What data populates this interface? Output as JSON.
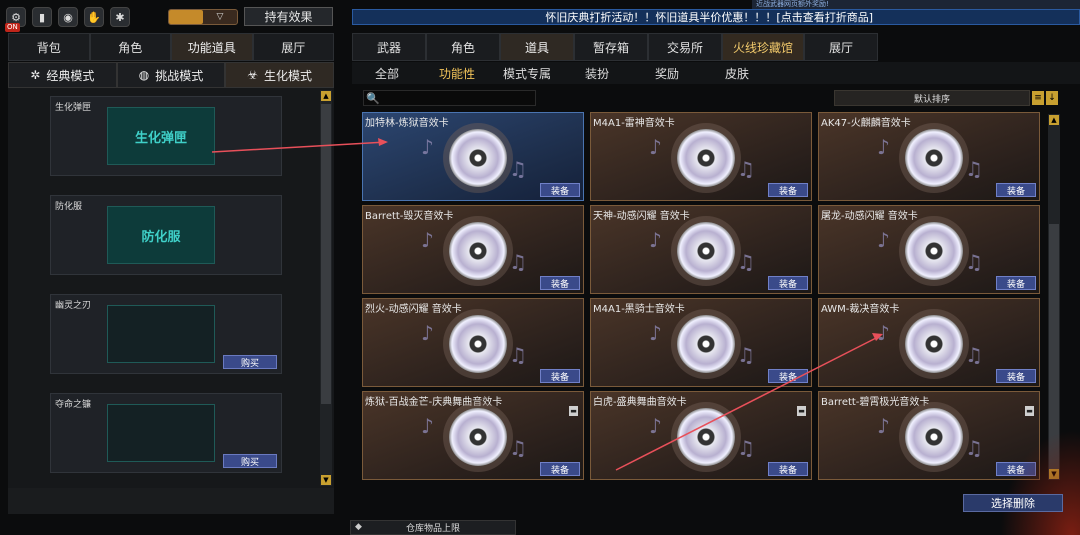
{
  "top": {
    "on_badge": "ON",
    "toggle": [
      "",
      "▽"
    ],
    "have_effect": "持有效果"
  },
  "banner": {
    "top_text": "近战武器网页额外奖励!",
    "text": "怀旧庆典打折活动！！怀旧道具半价优惠！！！[点击查看打折商品]"
  },
  "left": {
    "tabs": [
      "背包",
      "角色",
      "功能道具",
      "展厅"
    ],
    "selected_tab": 2,
    "modes": [
      {
        "label": "经典模式",
        "icon": "classic-mode-icon"
      },
      {
        "label": "挑战模式",
        "icon": "challenge-mode-icon"
      },
      {
        "label": "生化模式",
        "icon": "biohazard-mode-icon"
      }
    ],
    "selected_mode": 2,
    "items": [
      {
        "name": "生化弹匣",
        "art": "生化弹匣",
        "buy": ""
      },
      {
        "name": "防化服",
        "art": "防化服",
        "buy": ""
      },
      {
        "name": "幽灵之刃",
        "art": "",
        "buy": "购买"
      },
      {
        "name": "夺命之镰",
        "art": "",
        "buy": "购买"
      }
    ]
  },
  "right": {
    "tabs": [
      "武器",
      "角色",
      "道具",
      "暂存箱",
      "交易所",
      "火线珍藏馆",
      "展厅"
    ],
    "selected_tab": 2,
    "subtabs": [
      "全部",
      "功能性",
      "模式专属",
      "装扮",
      "奖励",
      "皮肤"
    ],
    "selected_subtab": 1,
    "search_placeholder": "",
    "sort_label": "默认排序",
    "equip_label": "装备",
    "cards": [
      {
        "name": "加特林-炼狱音效卡",
        "selected": true,
        "trash": false
      },
      {
        "name": "M4A1-雷神音效卡",
        "selected": false,
        "trash": false
      },
      {
        "name": "AK47-火麒麟音效卡",
        "selected": false,
        "trash": false
      },
      {
        "name": "Barrett-毁灭音效卡",
        "selected": false,
        "trash": false
      },
      {
        "name": "天神-动感闪耀 音效卡",
        "selected": false,
        "trash": false
      },
      {
        "name": "屠龙-动感闪耀 音效卡",
        "selected": false,
        "trash": false
      },
      {
        "name": "烈火-动感闪耀 音效卡",
        "selected": false,
        "trash": false
      },
      {
        "name": "M4A1-黑骑士音效卡",
        "selected": false,
        "trash": false
      },
      {
        "name": "AWM-裁决音效卡",
        "selected": false,
        "trash": false
      },
      {
        "name": "炼狱-百战金芒-庆典舞曲音效卡",
        "selected": false,
        "trash": true
      },
      {
        "name": "白虎-盛典舞曲音效卡",
        "selected": false,
        "trash": true
      },
      {
        "name": "Barrett-碧霄极光音效卡",
        "selected": false,
        "trash": true
      }
    ],
    "delete_label": "选择删除",
    "warehouse_label": "仓库物品上限"
  }
}
